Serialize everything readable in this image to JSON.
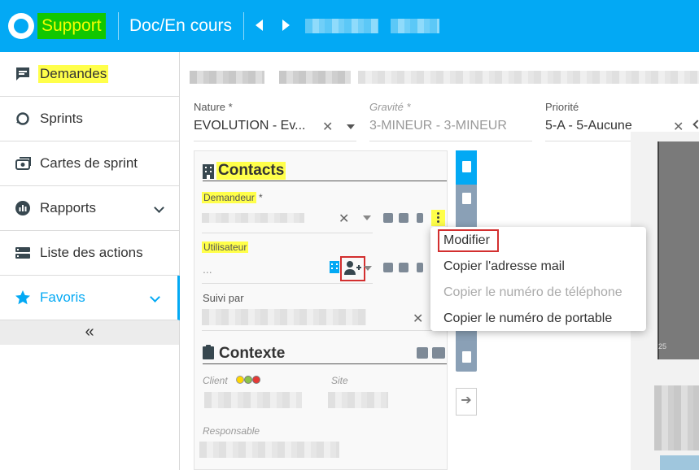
{
  "header": {
    "app_name": "Support",
    "breadcrumb": "Doc/En cours"
  },
  "sidebar": {
    "items": [
      {
        "label": "Demandes"
      },
      {
        "label": "Sprints"
      },
      {
        "label": "Cartes de sprint"
      },
      {
        "label": "Rapports"
      },
      {
        "label": "Liste des actions"
      },
      {
        "label": "Favoris"
      }
    ],
    "collapse_glyph": "«"
  },
  "form": {
    "nature": {
      "label": "Nature *",
      "value": "EVOLUTION - Ev..."
    },
    "gravite": {
      "label": "Gravité *",
      "value": "3-MINEUR - 3-MINEUR"
    },
    "priorite": {
      "label": "Priorité",
      "value": "5-A - 5-Aucune"
    }
  },
  "contacts": {
    "title": "Contacts",
    "demandeur_label": "Demandeur",
    "required_mark": "*",
    "utilisateur_label": "Utilisateur",
    "utilisateur_value": "...",
    "suivi_label": "Suivi par"
  },
  "contexte": {
    "title": "Contexte",
    "client_label": "Client",
    "site_label": "Site",
    "responsable_label": "Responsable"
  },
  "context_menu": {
    "items": [
      {
        "label": "Modifier",
        "enabled": true
      },
      {
        "label": "Copier l'adresse mail",
        "enabled": true
      },
      {
        "label": "Copier le numéro de téléphone",
        "enabled": false
      },
      {
        "label": "Copier le numéro de portable",
        "enabled": true
      }
    ]
  },
  "colors": {
    "primary": "#03a9f4",
    "highlight": "#ffff4a",
    "app_badge": "#12c700",
    "selection_outline": "#d32f2f"
  },
  "misc": {
    "partial_text": "25"
  }
}
